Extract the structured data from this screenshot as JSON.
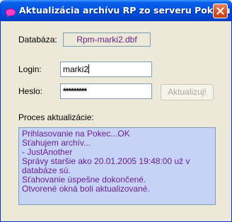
{
  "window": {
    "title": "Aktualizácia archívu RP zo serveru Pokecu",
    "icon": "pink-chat-bubble-icon",
    "accent_color": "#0055e5"
  },
  "form": {
    "database_label": "Databáza:",
    "database_value": "Rpm-marki2.dbf",
    "login_label": "Login:",
    "login_value": "marki2",
    "password_label": "Heslo:",
    "password_value": "*********",
    "update_button_label": "Aktualizuj!",
    "update_button_enabled": false
  },
  "log": {
    "label": "Proces aktualizácie:",
    "lines": [
      "Prihlasovanie na Pokec...OK",
      "Sťahujem archív...",
      "- JustAnother",
      "Správy staršie ako 20.01.2005 19:48:00 už v",
      "databáze sú.",
      "Sťahovanie úspešne dokončené.",
      "Otvorené okná boli aktualizované."
    ],
    "text_color": "#6a1f8c",
    "background_color": "#c6d3f7"
  }
}
